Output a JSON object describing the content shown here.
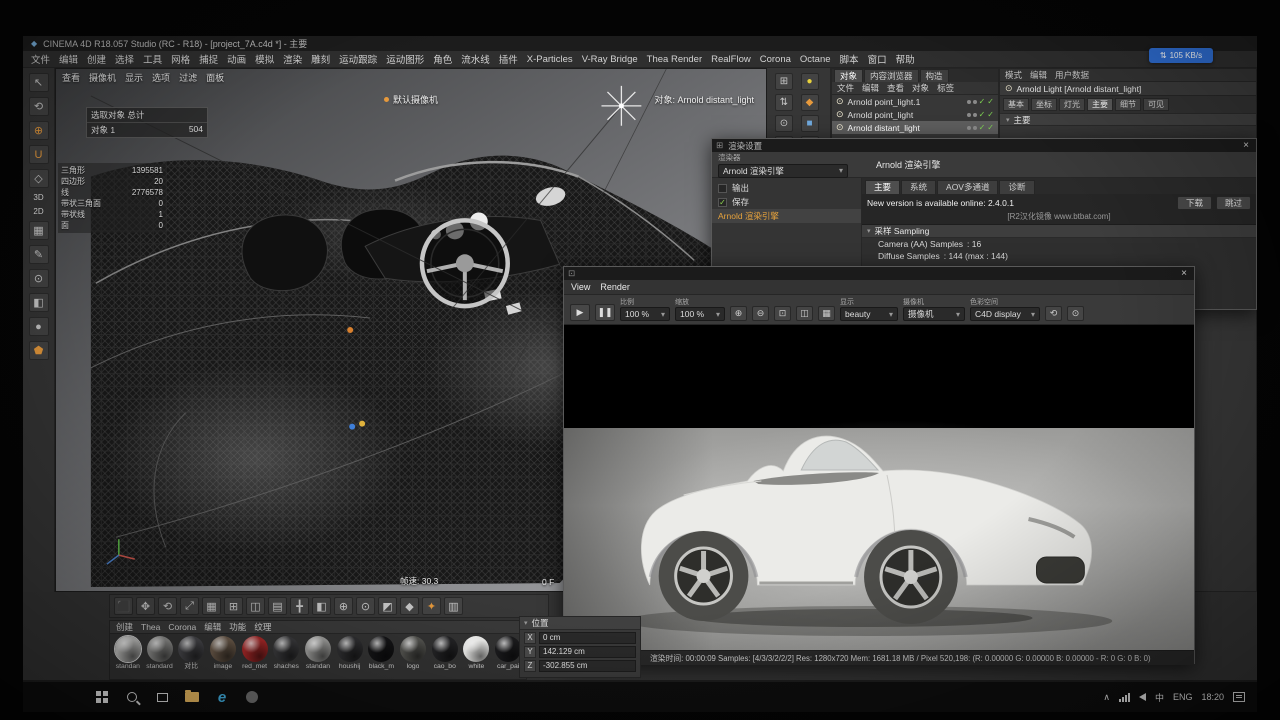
{
  "net_badge": {
    "icon": "⇅",
    "speed": "105 KB/s"
  },
  "window": {
    "title": "CINEMA 4D R18.057 Studio (RC - R18) - [project_7A.c4d *] - 主要"
  },
  "menubar": [
    "文件",
    "编辑",
    "创建",
    "选择",
    "工具",
    "网格",
    "捕捉",
    "动画",
    "模拟",
    "渲染",
    "雕刻",
    "运动跟踪",
    "运动图形",
    "角色",
    "流水线",
    "插件",
    "X-Particles",
    "V-Ray Bridge",
    "Thea Render",
    "RealFlow",
    "Corona",
    "Octane",
    "脚本",
    "窗口",
    "帮助"
  ],
  "left_toolbar": {
    "mode_3d": "3D",
    "mode_2d": "2D"
  },
  "viewport": {
    "menus": [
      "查看",
      "摄像机",
      "显示",
      "选项",
      "过滤",
      "面板"
    ],
    "hud_selection": "选取对象 总计",
    "hud_object": "对象 1",
    "hud_count": "504",
    "stats": [
      {
        "label": "三角形",
        "value": "1395581"
      },
      {
        "label": "四边形",
        "value": "20"
      },
      {
        "label": "线",
        "value": "2776578"
      },
      {
        "label": "带状三角面",
        "value": "0"
      },
      {
        "label": "带状线",
        "value": "1"
      },
      {
        "label": "面",
        "value": "0"
      }
    ],
    "camera_label": "默认摄像机",
    "object_label": "对象: Arnold distant_light",
    "fps": "帧速: 30.3",
    "frame": "0 F"
  },
  "object_manager": {
    "tabs": [
      "对象",
      "内容浏览器",
      "构造"
    ],
    "menu": [
      "文件",
      "编辑",
      "查看",
      "对象",
      "标签"
    ],
    "items": [
      {
        "label": "Arnold point_light.1"
      },
      {
        "label": "Arnold point_light"
      },
      {
        "label": "Arnold distant_light"
      }
    ]
  },
  "attribute_manager": {
    "menu": [
      "模式",
      "编辑",
      "用户数据"
    ],
    "title": "Arnold Light [Arnold distant_light]",
    "tabs": [
      "基本",
      "坐标",
      "灯光",
      "主要",
      "细节",
      "可见"
    ],
    "section": "主要"
  },
  "render_settings": {
    "window_title": "渲染设置",
    "renderer_label": "渲染器",
    "renderer_value": "Arnold 渲染引擎",
    "panel_title": "Arnold 渲染引擎",
    "tabs": [
      "主要",
      "系统",
      "AOV多通道",
      "诊断"
    ],
    "sidebar": [
      {
        "label": "输出"
      },
      {
        "label": "保存"
      },
      {
        "label": "Arnold 渲染引擎"
      }
    ],
    "update_notice": "New version is available online: 2.4.0.1",
    "mirror_note": "[R2汉化镜像 www.btbat.com]",
    "download": "下载",
    "skip": "跳过",
    "sampling_header": "采样 Sampling",
    "params": [
      {
        "label": "Camera (AA) Samples",
        "value": ": 16"
      },
      {
        "label": "Diffuse Samples",
        "value": ": 144   (max : 144)"
      }
    ]
  },
  "render_view": {
    "menu": [
      "View",
      "Render"
    ],
    "scale_label": "比例",
    "scale_value": "100 %",
    "zoom_label": "缩放",
    "zoom_value": "100 %",
    "display_label": "显示",
    "display_value": "beauty",
    "camera_label": "摄像机",
    "camera_value": "摄像机",
    "colorspace_label": "色彩空间",
    "colorspace_value": "C4D display",
    "status": "渲染时间: 00:00:09   Samples: [4/3/3/2/2/2]   Res: 1280x720   Mem: 1681.18 MB / Pixel 520,198: (R: 0.00000 G: 0.00000 B: 0.00000 - R: 0 G: 0 B: 0)"
  },
  "materials": {
    "menu": [
      "创建",
      "Thea",
      "Corona",
      "编辑",
      "功能",
      "纹理"
    ],
    "items": [
      {
        "label": "standan",
        "color": "#c0c0be"
      },
      {
        "label": "standard",
        "color": "#8e8e8c"
      },
      {
        "label": "对比",
        "color": "#46464a"
      },
      {
        "label": "image",
        "color": "#6b5a4a"
      },
      {
        "label": "red_met",
        "color": "#a82828"
      },
      {
        "label": "shaches",
        "color": "#39393b"
      },
      {
        "label": "standan",
        "color": "#9c9c9a"
      },
      {
        "label": "houshij",
        "color": "#2e2e30"
      },
      {
        "label": "black_m",
        "color": "#141416"
      },
      {
        "label": "logo",
        "color": "#53534f"
      },
      {
        "label": "cao_bo",
        "color": "#232325"
      },
      {
        "label": "white",
        "color": "#f1f1ef"
      },
      {
        "label": "car_pai",
        "color": "#1b1b1d"
      }
    ]
  },
  "coords": {
    "header": "位置",
    "rows": [
      {
        "axis": "X",
        "value": "0 cm"
      },
      {
        "axis": "Y",
        "value": "142.129 cm"
      },
      {
        "axis": "Z",
        "value": "-302.855 cm"
      }
    ]
  },
  "taskbar": {
    "ime": "中",
    "lang": "ENG",
    "time": "18:20"
  }
}
